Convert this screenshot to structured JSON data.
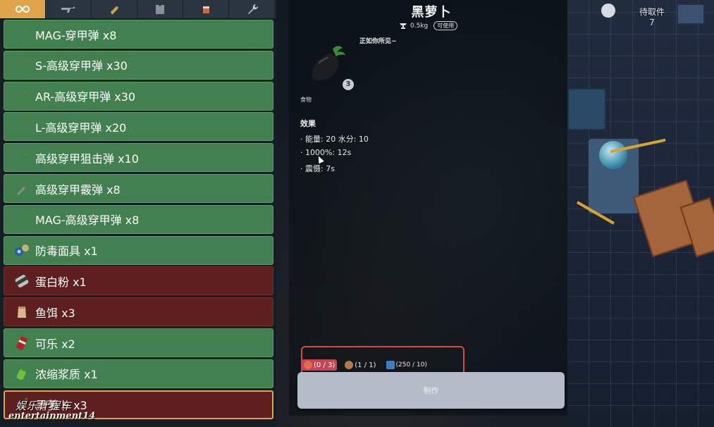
{
  "tabs": [
    {
      "name": "all-tab",
      "icon": "infinity-icon",
      "active": true
    },
    {
      "name": "weapons-tab",
      "icon": "rifle-icon",
      "active": false
    },
    {
      "name": "ammo-tab",
      "icon": "bullet-icon",
      "active": false
    },
    {
      "name": "armor-tab",
      "icon": "vest-icon",
      "active": false
    },
    {
      "name": "consumables-tab",
      "icon": "food-icon",
      "active": false
    },
    {
      "name": "tools-tab",
      "icon": "wrench-icon",
      "active": false
    }
  ],
  "inventory": {
    "items": [
      {
        "label": "MAG-穿甲弹 x8",
        "icon": "bullet-icon",
        "color": "green"
      },
      {
        "label": "S-高级穿甲弹 x30",
        "icon": "bullet-icon",
        "color": "green"
      },
      {
        "label": "AR-高级穿甲弹 x30",
        "icon": "bullet-icon",
        "color": "green"
      },
      {
        "label": "L-高级穿甲弹 x20",
        "icon": "bullet-icon",
        "color": "green"
      },
      {
        "label": "高级穿甲狙击弹 x10",
        "icon": "bullet-icon",
        "color": "green"
      },
      {
        "label": "高级穿甲霰弹 x8",
        "icon": "shell-icon",
        "color": "green"
      },
      {
        "label": "MAG-高级穿甲弹 x8",
        "icon": "bullet-icon",
        "color": "green"
      },
      {
        "label": "防毒面具 x1",
        "icon": "gas-mask-icon",
        "color": "green"
      },
      {
        "label": "蛋白粉 x1",
        "icon": "protein-can-icon",
        "color": "red"
      },
      {
        "label": "鱼饵 x3",
        "icon": "bait-bag-icon",
        "color": "red"
      },
      {
        "label": "可乐 x2",
        "icon": "cola-can-icon",
        "color": "green"
      },
      {
        "label": "浓缩浆质 x1",
        "icon": "green-bottle-icon",
        "color": "green"
      },
      {
        "label": "黑萝卜 x3",
        "icon": "black-carrot-icon",
        "color": "red",
        "selected": true
      }
    ]
  },
  "detail": {
    "title": "黑萝卜",
    "weight": "0.5kg",
    "usable": "可使用",
    "flavor": "正如你所见~",
    "count": "3",
    "category": "食物",
    "effects_title": "效果",
    "effects": [
      "· 能量: 20  水分: 10",
      "· 1000%: 12s",
      "· 震慑: 7s"
    ]
  },
  "requirements": [
    {
      "icon": "meat-icon",
      "text": "(0 / 3)",
      "missing": true
    },
    {
      "icon": "ore-icon",
      "text": "(1 / 1)",
      "missing": false
    },
    {
      "icon": "energy-icon",
      "text": "(250 / 10)",
      "missing": false
    }
  ],
  "craft_label": "制作",
  "world": {
    "pending_label": "待取件",
    "pending_count": "7"
  },
  "watermark": {
    "line1": "娱乐计程车",
    "line2": "entertainment14"
  },
  "colors": {
    "green_row": "#43804f",
    "red_row": "#5d1f1f",
    "accent": "#e0a44a",
    "alert": "#d8483e"
  }
}
